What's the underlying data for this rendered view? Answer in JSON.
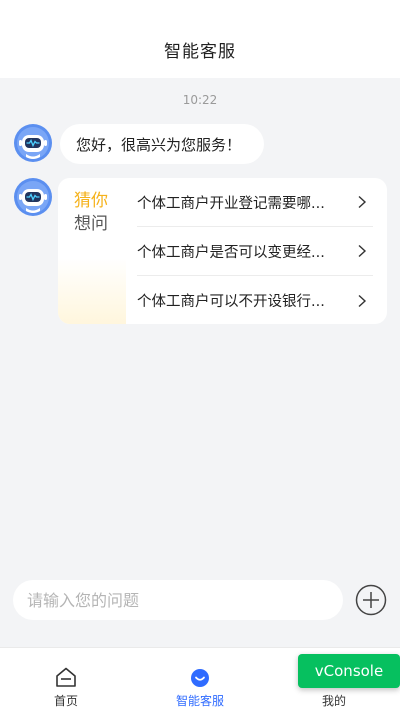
{
  "header": {
    "title": "智能客服"
  },
  "chat": {
    "timestamp": "10:22",
    "greeting": "您好，很高兴为您服务！",
    "guess": {
      "line1": "猜你",
      "line2": "想问",
      "questions": [
        {
          "text": "个体工商户开业登记需要哪..."
        },
        {
          "text": "个体工商户是否可以变更经..."
        },
        {
          "text": "个体工商户可以不开设银行..."
        }
      ]
    }
  },
  "input": {
    "placeholder": "请输入您的问题"
  },
  "tabbar": {
    "tabs": [
      {
        "label": "首页",
        "icon": "home-icon"
      },
      {
        "label": "智能客服",
        "icon": "service-icon",
        "active": true
      },
      {
        "label": "我的",
        "icon": "profile-icon"
      }
    ]
  },
  "vconsole": {
    "label": "vConsole"
  },
  "colors": {
    "accent": "#2f6bff",
    "guess_highlight": "#f5b21b",
    "vconsole_green": "#06c05f",
    "page_bg": "#f3f4f6"
  }
}
